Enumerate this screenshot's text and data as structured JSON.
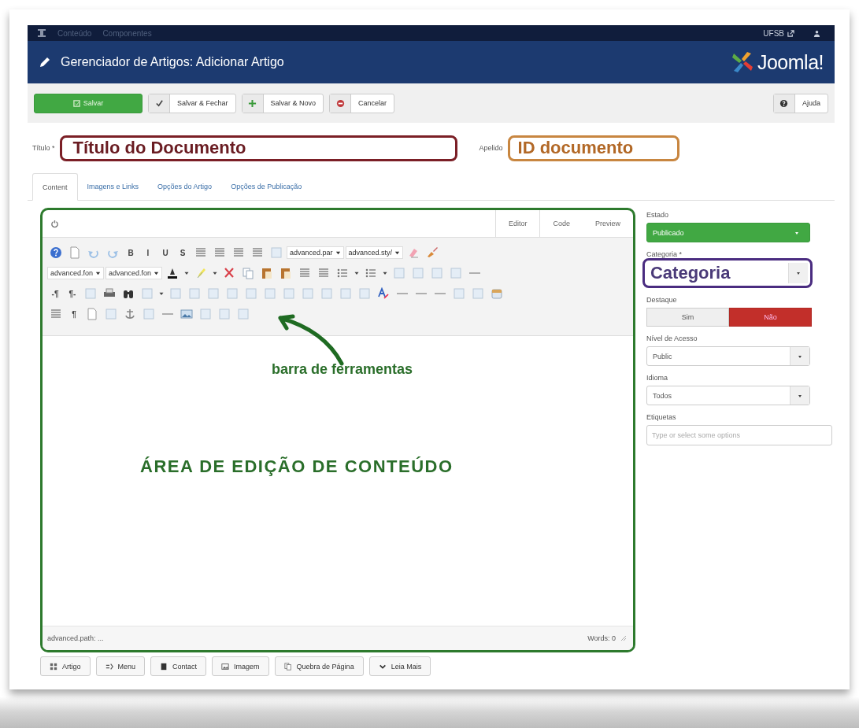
{
  "top_nav": {
    "items": [
      "Conteúdo",
      "Componentes"
    ],
    "site": "UFSB"
  },
  "header": {
    "title": "Gerenciador de Artigos: Adicionar Artigo",
    "logo": "Joomla!"
  },
  "toolbar": {
    "buttons": [
      {
        "label": "Salvar",
        "kind": "primary"
      },
      {
        "label": "Salvar & Fechar",
        "kind": "check"
      },
      {
        "label": "Salvar & Novo",
        "kind": "plus"
      },
      {
        "label": "Cancelar",
        "kind": "cancel"
      }
    ],
    "help": "Ajuda"
  },
  "title_field": {
    "label": "Título *",
    "value": "Título do Documento"
  },
  "alias_field": {
    "label": "Apelido",
    "value": "ID documento"
  },
  "tabs": [
    {
      "label": "Content",
      "selected": true
    },
    {
      "label": "Imagens e Links",
      "selected": false
    },
    {
      "label": "Opções do Artigo",
      "selected": false
    },
    {
      "label": "Opções de Publicação",
      "selected": false
    }
  ],
  "editor": {
    "modes": [
      {
        "label": "Editor",
        "selected": true
      },
      {
        "label": "Code",
        "selected": false
      },
      {
        "label": "Preview",
        "selected": false
      }
    ],
    "toolbar_rows": [
      [
        {
          "kind": "help"
        },
        {
          "kind": "page"
        },
        {
          "kind": "undo"
        },
        {
          "kind": "redo"
        },
        {
          "kind": "glyph",
          "label": "B"
        },
        {
          "kind": "glyph",
          "label": "I"
        },
        {
          "kind": "glyph",
          "label": "U"
        },
        {
          "kind": "glyph",
          "label": "S"
        },
        {
          "kind": "align"
        },
        {
          "kind": "align"
        },
        {
          "kind": "align"
        },
        {
          "kind": "align"
        },
        {
          "kind": "box"
        },
        {
          "kind": "dropdown",
          "label": "advanced.par"
        },
        {
          "kind": "dropdown",
          "label": "advanced.sty/"
        },
        {
          "kind": "eraser"
        },
        {
          "kind": "brush"
        }
      ],
      [
        {
          "kind": "dropdown",
          "label": "advanced.fon"
        },
        {
          "kind": "dropdown",
          "label": "advanced.fon"
        },
        {
          "kind": "color"
        },
        {
          "kind": "caret"
        },
        {
          "kind": "highlight"
        },
        {
          "kind": "caret"
        },
        {
          "kind": "cut"
        },
        {
          "kind": "copy"
        },
        {
          "kind": "paste"
        },
        {
          "kind": "paste"
        },
        {
          "kind": "align"
        },
        {
          "kind": "align"
        },
        {
          "kind": "list"
        },
        {
          "kind": "caret"
        },
        {
          "kind": "list"
        },
        {
          "kind": "caret"
        },
        {
          "kind": "box"
        },
        {
          "kind": "box"
        },
        {
          "kind": "box"
        },
        {
          "kind": "box"
        },
        {
          "kind": "rule"
        }
      ],
      [
        {
          "kind": "glyph",
          "label": "-¶"
        },
        {
          "kind": "glyph",
          "label": "¶-"
        },
        {
          "kind": "box"
        },
        {
          "kind": "print"
        },
        {
          "kind": "find"
        },
        {
          "kind": "box"
        },
        {
          "kind": "caret"
        },
        {
          "kind": "box"
        },
        {
          "kind": "box"
        },
        {
          "kind": "box"
        },
        {
          "kind": "box"
        },
        {
          "kind": "box"
        },
        {
          "kind": "box"
        },
        {
          "kind": "box"
        },
        {
          "kind": "box"
        },
        {
          "kind": "box"
        },
        {
          "kind": "box"
        },
        {
          "kind": "box"
        },
        {
          "kind": "spell"
        },
        {
          "kind": "rule"
        },
        {
          "kind": "rule"
        },
        {
          "kind": "rule"
        },
        {
          "kind": "box"
        },
        {
          "kind": "box"
        },
        {
          "kind": "media"
        }
      ],
      [
        {
          "kind": "align"
        },
        {
          "kind": "glyph",
          "label": "¶"
        },
        {
          "kind": "page"
        },
        {
          "kind": "box"
        },
        {
          "kind": "anchor"
        },
        {
          "kind": "box"
        },
        {
          "kind": "rule"
        },
        {
          "kind": "image"
        },
        {
          "kind": "box"
        },
        {
          "kind": "box"
        },
        {
          "kind": "box"
        }
      ]
    ],
    "annotations": [
      "barra de ferramentas",
      "ÁREA DE EDIÇÃO DE CONTEÚDO"
    ],
    "path": "advanced.path: ...",
    "words": "Words: 0"
  },
  "insert_buttons": [
    {
      "label": "Artigo",
      "kind": "article"
    },
    {
      "label": "Menu",
      "kind": "menu"
    },
    {
      "label": "Contact",
      "kind": "contact"
    },
    {
      "label": "Imagem",
      "kind": "image"
    },
    {
      "label": "Quebra de Página",
      "kind": "pagebreak"
    },
    {
      "label": "Leia Mais",
      "kind": "readmore"
    }
  ],
  "sidebar": {
    "status": {
      "label": "Estado",
      "value": "Publicado"
    },
    "category": {
      "label": "Categoria *",
      "value": "Categoria"
    },
    "featured": {
      "label": "Destaque",
      "options": [
        {
          "label": "Sim",
          "selected": false
        },
        {
          "label": "Não",
          "selected": true
        }
      ]
    },
    "access": {
      "label": "Nível de Acesso",
      "value": "Public"
    },
    "language": {
      "label": "Idioma",
      "value": "Todos"
    },
    "tags": {
      "label": "Etiquetas",
      "placeholder": "Type or select some options"
    }
  }
}
